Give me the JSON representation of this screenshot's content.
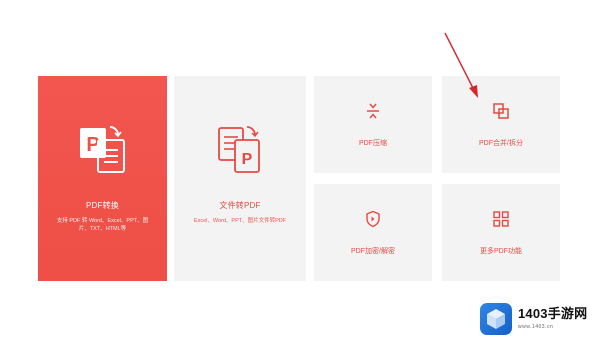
{
  "colors": {
    "accent": "#ee4f47",
    "tile_bg": "#f3f3f3",
    "arrow": "#d9262a",
    "watermark_blue": "#1f6fd6"
  },
  "tiles": {
    "pdf_convert": {
      "title": "PDF转换",
      "desc": "支持 PDF 转 Word、Excel、PPT、图片、TXT、HTML等",
      "icon": "ppt-to-doc-icon"
    },
    "file_to_pdf": {
      "title": "文件转PDF",
      "desc": "Excel、Word、PPT、图片文件转PDF",
      "icon": "docs-to-pdf-icon"
    },
    "pdf_compress": {
      "label": "PDF压缩",
      "icon": "compress-icon"
    },
    "pdf_merge_split": {
      "label": "PDF合并/拆分",
      "icon": "merge-split-icon"
    },
    "pdf_encrypt": {
      "label": "PDF加密/解密",
      "icon": "shield-lock-icon"
    },
    "more_tools": {
      "label": "更多PDF功能",
      "icon": "grid-apps-icon"
    }
  },
  "watermark": {
    "title": "1403手游网",
    "url": "www.1403.cn",
    "icon": "cube-logo-icon"
  }
}
